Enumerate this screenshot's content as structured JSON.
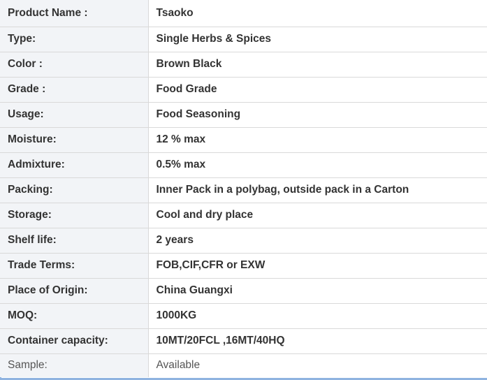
{
  "table": {
    "rows": [
      {
        "label": "Product Name :",
        "value": "Tsaoko"
      },
      {
        "label": "Type:",
        "value": "Single Herbs & Spices"
      },
      {
        "label": "Color :",
        "value": "Brown Black"
      },
      {
        "label": "Grade :",
        "value": "Food Grade"
      },
      {
        "label": "Usage:",
        "value": "Food Seasoning"
      },
      {
        "label": "Moisture:",
        "value": "12 % max"
      },
      {
        "label": "Admixture:",
        "value": "0.5% max"
      },
      {
        "label": "Packing:",
        "value": "Inner Pack in a polybag, outside pack in a Carton"
      },
      {
        "label": "Storage:",
        "value": "Cool and dry place"
      },
      {
        "label": "Shelf life:",
        "value": "2 years"
      },
      {
        "label": "Trade Terms:",
        "value": "FOB,CIF,CFR or EXW"
      },
      {
        "label": "Place of Origin:",
        "value": "China Guangxi"
      },
      {
        "label": "MOQ:",
        "value": "1000KG"
      },
      {
        "label": "Container capacity:",
        "value": "10MT/20FCL ,16MT/40HQ"
      },
      {
        "label": "Sample:",
        "value": "Available"
      }
    ]
  },
  "colors": {
    "label_background": "#f2f4f7",
    "border_accent": "#8fb3e0",
    "text": "#333333"
  }
}
